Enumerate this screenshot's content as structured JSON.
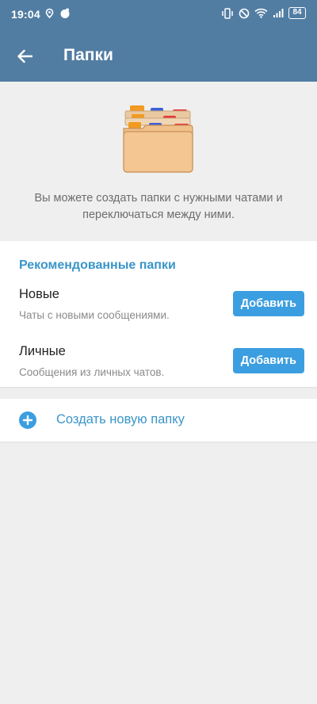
{
  "status_bar": {
    "time": "19:04",
    "battery": "84",
    "icons": [
      "location-icon",
      "notification-dot-icon",
      "vibrate-icon",
      "dnd-icon",
      "wifi-icon",
      "signal-icon",
      "battery-icon"
    ]
  },
  "toolbar": {
    "title": "Папки",
    "back_icon": "arrow-left-icon"
  },
  "hero": {
    "illustration": "folders-icon",
    "description": "Вы можете создать папки с нужными чатами и переключаться между ними."
  },
  "recommended": {
    "header": "Рекомендованные папки",
    "items": [
      {
        "title": "Новые",
        "subtitle": "Чаты с новыми сообщениями.",
        "button": "Добавить"
      },
      {
        "title": "Личные",
        "subtitle": "Сообщения из личных чатов.",
        "button": "Добавить"
      }
    ]
  },
  "create": {
    "label": "Создать новую папку",
    "icon": "plus-circle-icon"
  },
  "colors": {
    "app_bar": "#527da3",
    "accent": "#3a95c8",
    "button": "#3b9ee0",
    "background": "#efefef"
  }
}
